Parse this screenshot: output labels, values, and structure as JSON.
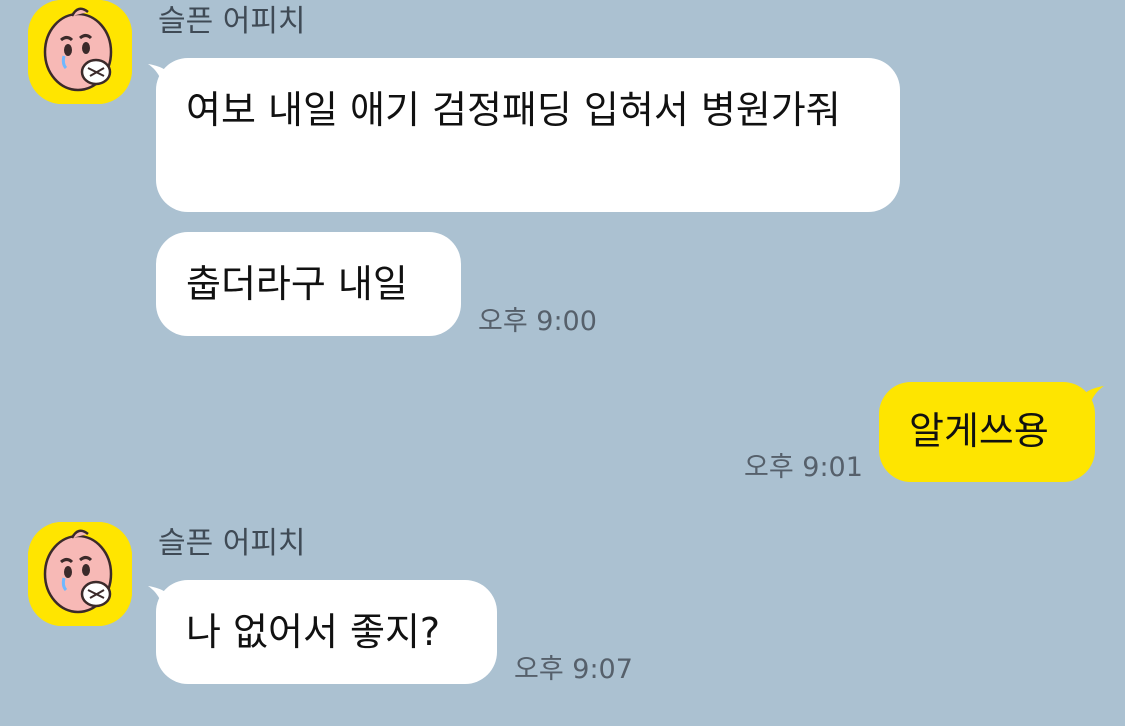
{
  "chat": {
    "colors": {
      "background": "#abc1d1",
      "incoming_bubble": "#ffffff",
      "outgoing_bubble": "#fee500",
      "avatar_background": "#ffe500"
    },
    "groups": [
      {
        "sender": "슬픈 어피치",
        "avatar_icon": "apeach-crying-icon",
        "messages": [
          {
            "text": "여보 내일 애기 검정패딩 입혀서 병원가줘"
          },
          {
            "text": "춥더라구 내일",
            "time": "오후 9:00"
          }
        ]
      },
      {
        "sender": "me",
        "messages": [
          {
            "text": "알게쓰용",
            "time": "오후 9:01"
          }
        ]
      },
      {
        "sender": "슬픈 어피치",
        "avatar_icon": "apeach-crying-icon",
        "messages": [
          {
            "text": "나 없어서 좋지?",
            "time": "오후 9:07"
          }
        ]
      }
    ]
  }
}
